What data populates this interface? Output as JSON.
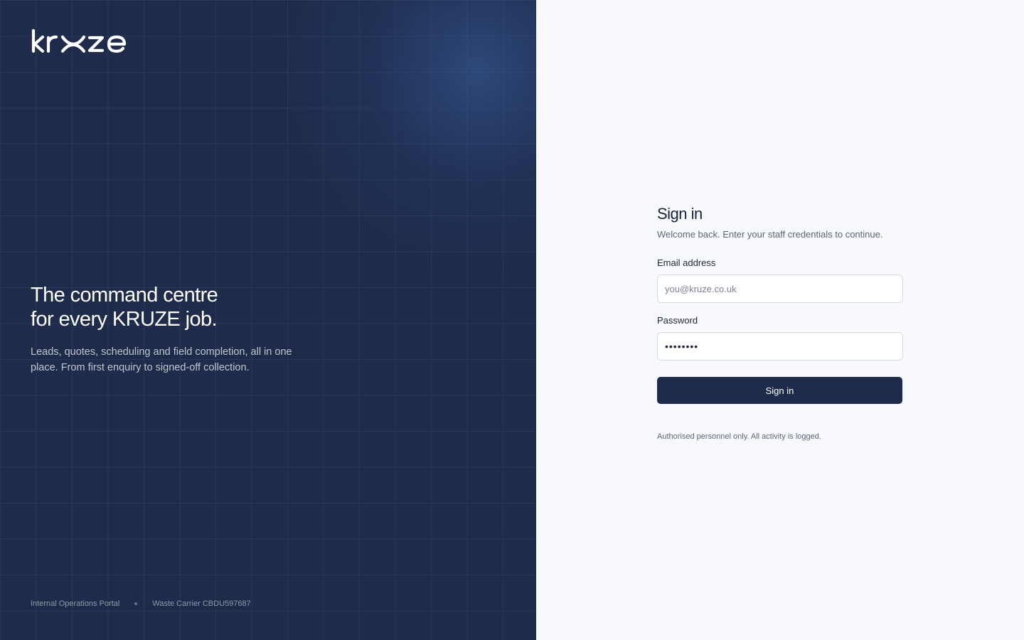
{
  "brand": {
    "logo_text": "kruze"
  },
  "hero": {
    "title_line1": "The command centre",
    "title_line2": "for every KRUZE job.",
    "subtitle": "Leads, quotes, scheduling and field completion, all in one place. From first enquiry to signed-off collection."
  },
  "footer": {
    "portal_label": "Internal Operations Portal",
    "carrier_label": "Waste Carrier CBDU597687"
  },
  "signin": {
    "title": "Sign in",
    "subtitle": "Welcome back. Enter your staff credentials to continue.",
    "email_label": "Email address",
    "email_placeholder": "you@kruze.co.uk",
    "password_label": "Password",
    "password_value": "••••••••",
    "button_label": "Sign in",
    "notice": "Authorised personnel only. All activity is logged."
  },
  "colors": {
    "panel": "#1e2b4a",
    "page_bg": "#f7f9fc",
    "button": "#1e2b4a"
  }
}
